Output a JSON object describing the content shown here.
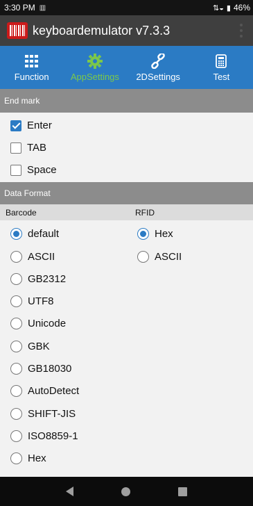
{
  "status_bar": {
    "time": "3:30 PM",
    "notif_icon": "barcode-notification",
    "battery": "46%"
  },
  "app_bar": {
    "title": "keyboardemulator v7.3.3",
    "icon": "barcode-app-icon"
  },
  "tabs": [
    {
      "label": "Function",
      "icon": "grid-icon",
      "active": false
    },
    {
      "label": "AppSettings",
      "icon": "gear-icon",
      "active": true
    },
    {
      "label": "2DSettings",
      "icon": "link-icon",
      "active": false
    },
    {
      "label": "Test",
      "icon": "calculator-icon",
      "active": false
    }
  ],
  "end_mark": {
    "header": "End mark",
    "options": [
      {
        "label": "Enter",
        "checked": true
      },
      {
        "label": "TAB",
        "checked": false
      },
      {
        "label": "Space",
        "checked": false
      }
    ]
  },
  "data_format": {
    "header": "Data Format",
    "barcode_label": "Barcode",
    "rfid_label": "RFID",
    "barcode_options": [
      {
        "label": "default",
        "selected": true
      },
      {
        "label": "ASCII",
        "selected": false
      },
      {
        "label": "GB2312",
        "selected": false
      },
      {
        "label": "UTF8",
        "selected": false
      },
      {
        "label": "Unicode",
        "selected": false
      },
      {
        "label": "GBK",
        "selected": false
      },
      {
        "label": "GB18030",
        "selected": false
      },
      {
        "label": "AutoDetect",
        "selected": false
      },
      {
        "label": "SHIFT-JIS",
        "selected": false
      },
      {
        "label": "ISO8859-1",
        "selected": false
      },
      {
        "label": "Hex",
        "selected": false
      }
    ],
    "rfid_options": [
      {
        "label": "Hex",
        "selected": true
      },
      {
        "label": "ASCII",
        "selected": false
      }
    ]
  },
  "colors": {
    "accent": "#2b7bc4",
    "active_tab": "#7cc84a",
    "app_bar": "#3f3f3f",
    "section": "#8c8c8c"
  }
}
